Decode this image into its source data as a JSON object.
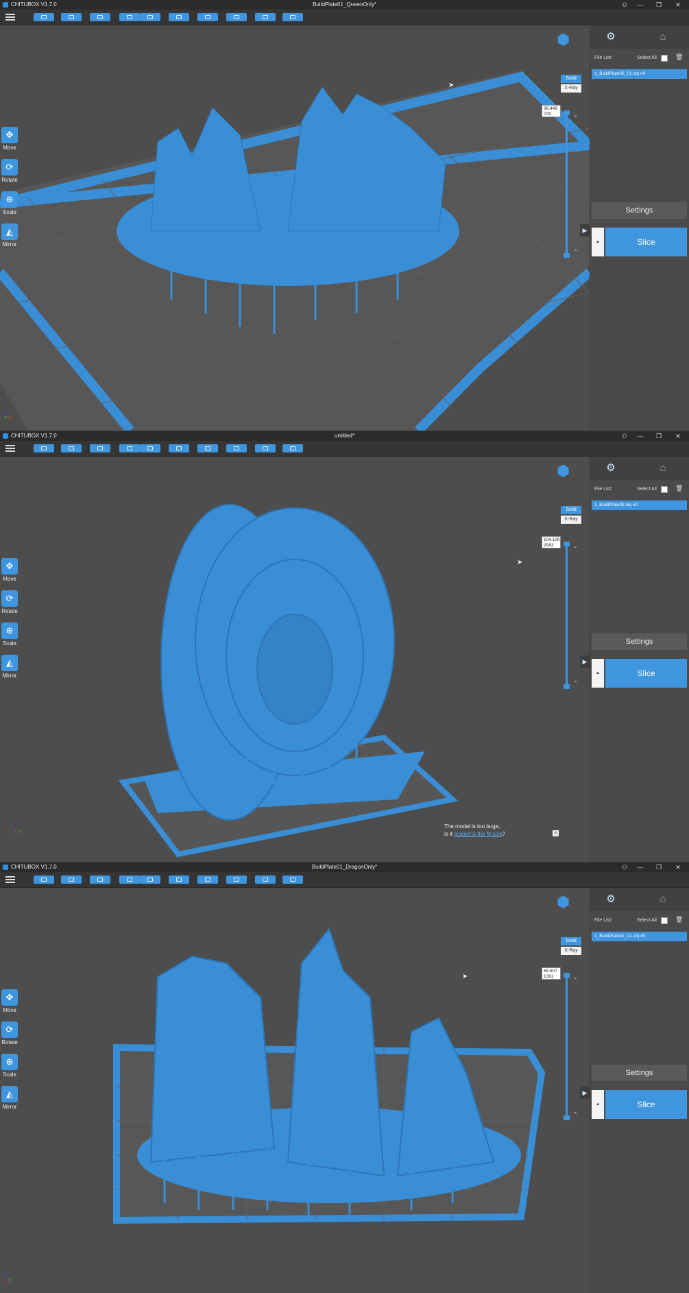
{
  "app_title": "CHITUBOX V1.7.0",
  "windows": [
    {
      "doc_title": "BuildPlate01_QueenOnly*",
      "file_list_label": "File List:",
      "select_all_label": "Select All",
      "file_item": "1_BuildPlate02_01.obj #0",
      "settings_label": "Settings",
      "slice_label": "Slice",
      "solid_label": "Solid",
      "xray_label": "X-Ray",
      "slider_value": "36.449",
      "slider_layer": "729",
      "tools": [
        "Move",
        "Rotate",
        "Scale",
        "Mirror"
      ]
    },
    {
      "doc_title": "untitled*",
      "file_list_label": "File List:",
      "select_all_label": "Select All",
      "file_item": "1_BuildPlate02.obj #0",
      "settings_label": "Settings",
      "slice_label": "Slice",
      "solid_label": "Solid",
      "xray_label": "X-Ray",
      "slider_value": "104.130",
      "slider_layer": "2083",
      "tools": [
        "Move",
        "Rotate",
        "Scale",
        "Mirror"
      ],
      "notice_line1": "The model is too large,",
      "notice_line2_prefix": "is it",
      "notice_link": "scaled to the fit size",
      "notice_suffix": "?"
    },
    {
      "doc_title": "BuildPlate01_DragonOnly*",
      "file_list_label": "File List:",
      "select_all_label": "Select All",
      "file_item": "1_BuildPlate02_02.obj #0",
      "settings_label": "Settings",
      "slice_label": "Slice",
      "solid_label": "Solid",
      "xray_label": "X-Ray",
      "slider_value": "69.507",
      "slider_layer": "1391",
      "tools": [
        "Move",
        "Rotate",
        "Scale",
        "Mirror"
      ]
    }
  ],
  "icons": {
    "tools": [
      "move-icon",
      "rotate-icon",
      "scale-icon",
      "mirror-icon"
    ],
    "panel_tabs": [
      "settings-tab-icon",
      "supports-tab-icon"
    ]
  },
  "colors": {
    "accent": "#3f96de",
    "model": "#3a8ed6",
    "plate": "#5d5d5d",
    "background": "#4d4d4d"
  }
}
